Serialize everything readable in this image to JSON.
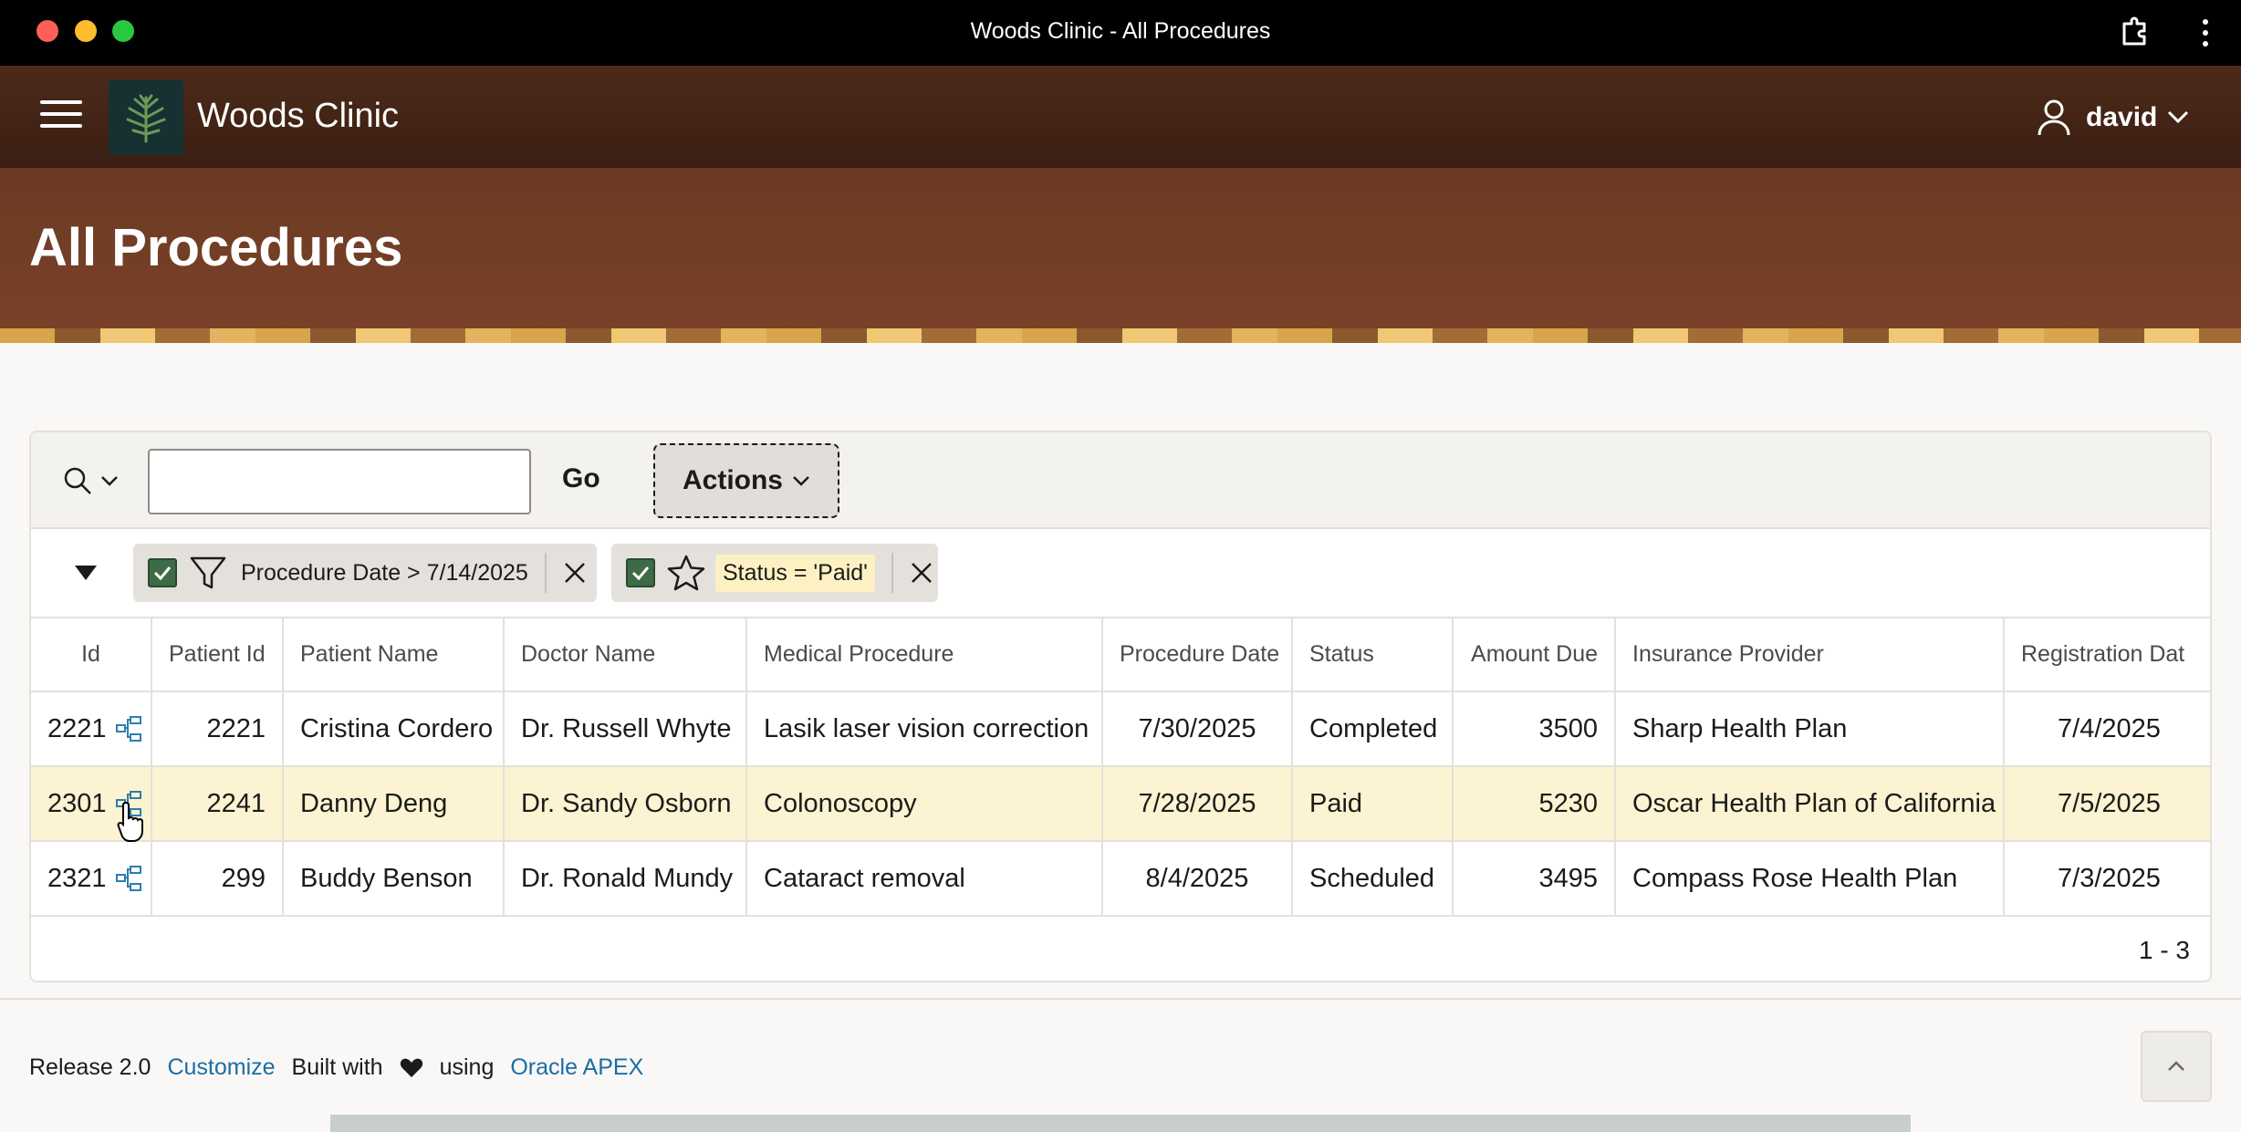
{
  "window": {
    "title": "Woods Clinic - All Procedures"
  },
  "header": {
    "app_name": "Woods Clinic",
    "user": "david"
  },
  "page": {
    "title": "All Procedures"
  },
  "toolbar": {
    "search_placeholder": "",
    "go_label": "Go",
    "actions_label": "Actions"
  },
  "filters": [
    {
      "label": "Procedure Date > 7/14/2025",
      "icon": "filter-icon",
      "checked": true
    },
    {
      "label": "Status = 'Paid'",
      "icon": "star-icon",
      "checked": true
    }
  ],
  "table": {
    "columns": [
      "Id",
      "Patient Id",
      "Patient Name",
      "Doctor Name",
      "Medical Procedure",
      "Procedure Date",
      "Status",
      "Amount Due",
      "Insurance Provider",
      "Registration Dat"
    ],
    "rows": [
      [
        "2221",
        "2221",
        "Cristina Cordero",
        "Dr. Russell Whyte",
        "Lasik laser vision correction",
        "7/30/2025",
        "Completed",
        "3500",
        "Sharp Health Plan",
        "7/4/2025"
      ],
      [
        "2301",
        "2241",
        "Danny Deng",
        "Dr. Sandy Osborn",
        "Colonoscopy",
        "7/28/2025",
        "Paid",
        "5230",
        "Oscar Health Plan of California",
        "7/5/2025"
      ],
      [
        "2321",
        "299",
        "Buddy Benson",
        "Dr. Ronald Mundy",
        "Cataract removal",
        "8/4/2025",
        "Scheduled",
        "3495",
        "Compass Rose Health Plan",
        "7/3/2025"
      ]
    ],
    "pagination": "1 - 3"
  },
  "footer": {
    "release": "Release 2.0",
    "customize": "Customize",
    "built_with": "Built with",
    "using": "using",
    "apex": "Oracle APEX"
  },
  "colors": {
    "header": "#3b1f13",
    "hero": "#7a4228",
    "selected_row": "#fcf3d2",
    "link": "#1a6ea6",
    "check": "#3d6b46"
  }
}
